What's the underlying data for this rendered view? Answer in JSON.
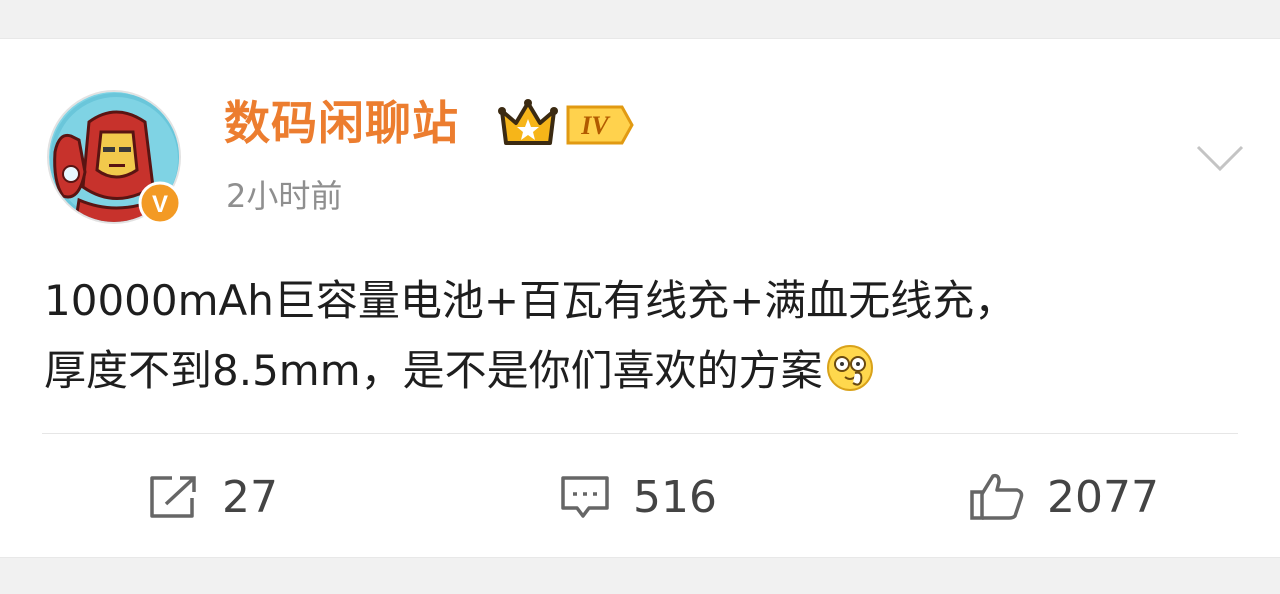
{
  "post": {
    "username": "数码闲聊站",
    "level_badge": "IV",
    "timestamp": "2小时前",
    "content_line1": "10000mAh巨容量电池+百瓦有线充+满血无线充，",
    "content_line2": "厚度不到8.5mm，是不是你们喜欢的方案",
    "emoji_name": "doge-emoji",
    "verified_badge": "V"
  },
  "actions": {
    "repost_count": "27",
    "comment_count": "516",
    "like_count": "2077"
  },
  "colors": {
    "username": "#ec7d2f",
    "timestamp": "#8f8f8f",
    "text": "#1e1e1e",
    "verified": "#f39a24",
    "crown": "#f6b519"
  },
  "icons": {
    "more": "chevron-down-icon",
    "repost": "share-icon",
    "comment": "comment-icon",
    "like": "thumbs-up-icon"
  }
}
